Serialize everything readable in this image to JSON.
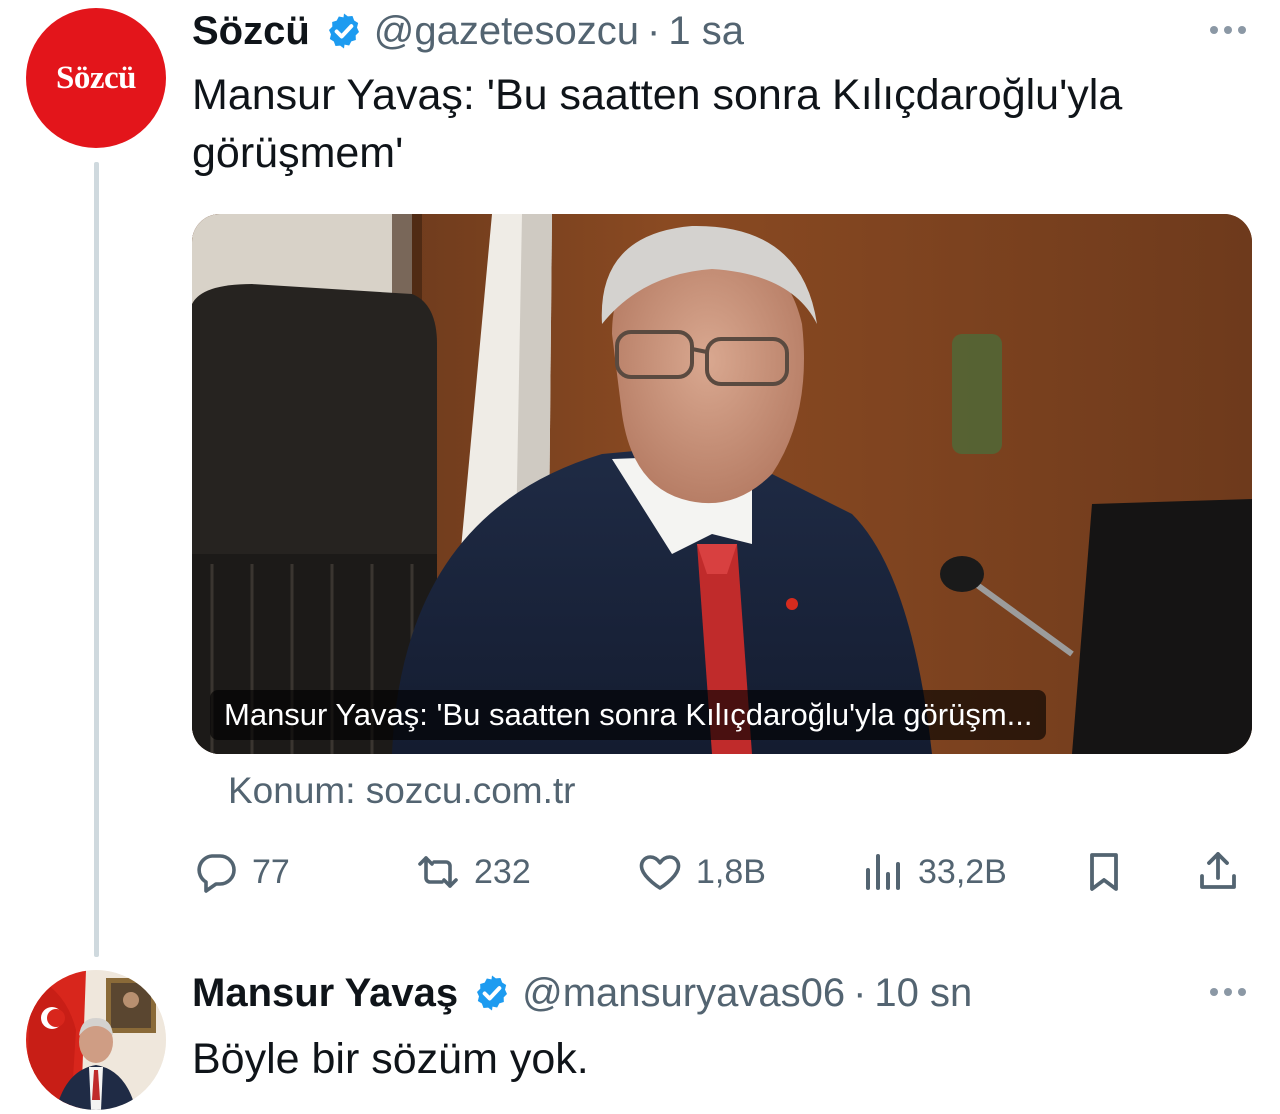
{
  "tweets": [
    {
      "display_name": "Sözcü",
      "handle": "@gazetesozcu",
      "separator": "·",
      "time": "1 sa",
      "avatar_text": "Sözcü",
      "text": "Mansur Yavaş: 'Bu saatten sonra Kılıçdaroğlu'yla görüşmem'",
      "card": {
        "caption": "Mansur Yavaş: 'Bu saatten sonra Kılıçdaroğlu'yla görüşm...",
        "source": "Konum: sozcu.com.tr"
      },
      "actions": {
        "replies": "77",
        "retweets": "232",
        "likes": "1,8B",
        "views": "33,2B"
      }
    },
    {
      "display_name": "Mansur Yavaş",
      "handle": "@mansuryavas06",
      "separator": "·",
      "time": "10 sn",
      "text": "Böyle bir sözüm yok."
    }
  ],
  "icons": {
    "verified": "verified-badge-icon",
    "more": "more-options-icon",
    "reply": "reply-icon",
    "retweet": "retweet-icon",
    "like": "heart-icon",
    "views": "views-chart-icon",
    "bookmark": "bookmark-icon",
    "share": "share-icon"
  },
  "colors": {
    "brand_red": "#e3151b",
    "verified_blue": "#1d9bf0",
    "secondary_text": "#536471",
    "thread_line": "#cfd9de"
  }
}
